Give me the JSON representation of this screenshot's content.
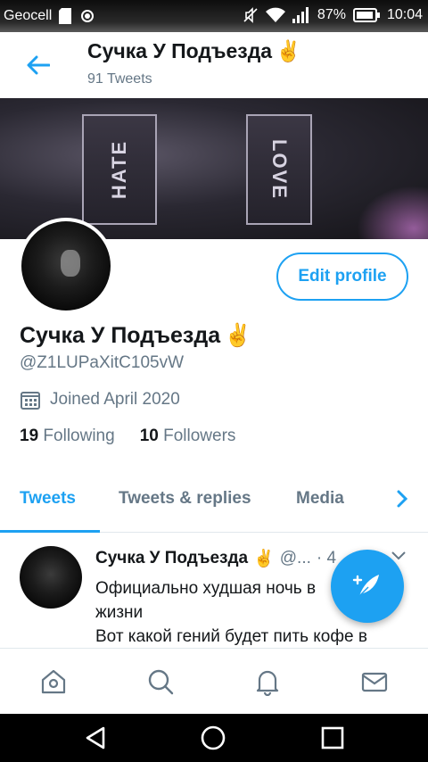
{
  "status_bar": {
    "carrier": "Geocell",
    "battery": "87%",
    "time": "10:04"
  },
  "header": {
    "title": "Сучка У Подъезда",
    "emoji": "✌️",
    "subtitle": "91 Tweets"
  },
  "banner": {
    "chip_left": "HATE",
    "chip_right": "LOVE"
  },
  "profile": {
    "edit_button": "Edit profile",
    "name": "Сучка У Подъезда",
    "emoji": "✌️",
    "handle": "@Z1LUPaXitC105vW",
    "joined": "Joined April 2020",
    "following_count": "19",
    "following_label": "Following",
    "followers_count": "10",
    "followers_label": "Followers"
  },
  "tabs": [
    {
      "label": "Tweets",
      "active": true
    },
    {
      "label": "Tweets & replies",
      "active": false
    },
    {
      "label": "Media",
      "active": false
    }
  ],
  "tweet": {
    "name": "Сучка У Подъезда",
    "emoji": "✌️",
    "handle": "@...",
    "dot_time": "· 4",
    "line1": "Официально худшая ночь в",
    "line2": "жизни",
    "line3": "Вот какой гений будет пить кофе в"
  },
  "colors": {
    "accent": "#1da1f2",
    "muted": "#657786",
    "text": "#14171a"
  },
  "icons": {
    "back": "arrow-left-icon",
    "calendar": "calendar-icon",
    "compose": "compose-feather-icon",
    "home": "home-icon",
    "search": "search-icon",
    "notifications": "bell-icon",
    "messages": "mail-icon"
  }
}
